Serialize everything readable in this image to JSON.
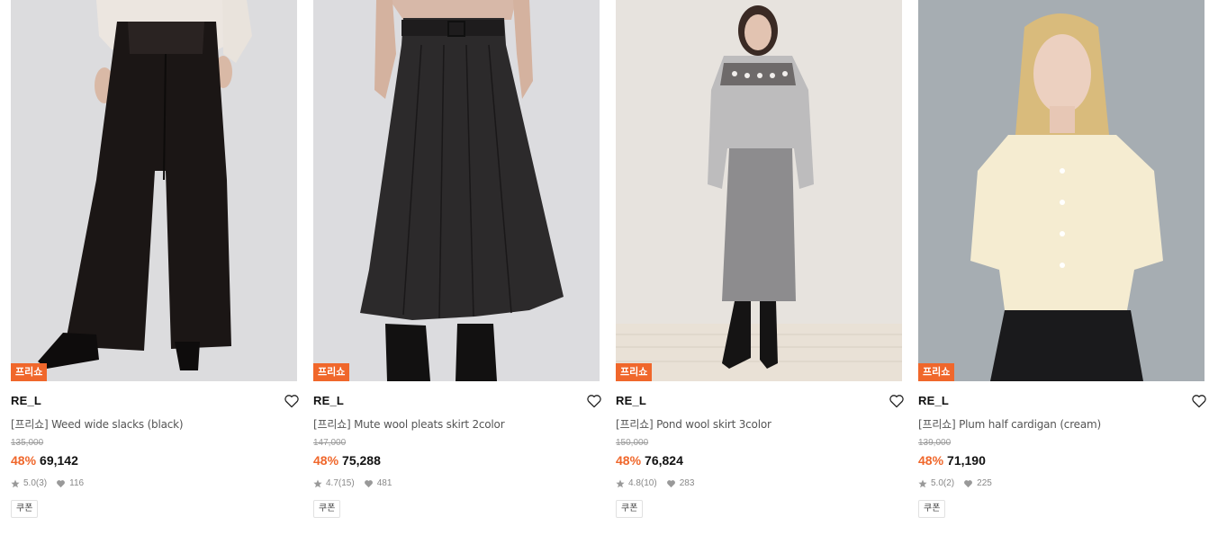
{
  "products": [
    {
      "badge": "프리쇼",
      "brand": "RE_L",
      "name": "[프리쇼] Weed wide slacks (black)",
      "original_price": "135,000",
      "discount": "48%",
      "price": "69,142",
      "rating": "5.0",
      "review_count": "(3)",
      "likes": "116",
      "coupon": "쿠폰"
    },
    {
      "badge": "프리쇼",
      "brand": "RE_L",
      "name": "[프리쇼] Mute wool pleats skirt 2color",
      "original_price": "147,000",
      "discount": "48%",
      "price": "75,288",
      "rating": "4.7",
      "review_count": "(15)",
      "likes": "481",
      "coupon": "쿠폰"
    },
    {
      "badge": "프리쇼",
      "brand": "RE_L",
      "name": "[프리쇼] Pond wool skirt 3color",
      "original_price": "150,000",
      "discount": "48%",
      "price": "76,824",
      "rating": "4.8",
      "review_count": "(10)",
      "likes": "283",
      "coupon": "쿠폰"
    },
    {
      "badge": "프리쇼",
      "brand": "RE_L",
      "name": "[프리쇼] Plum half cardigan (cream)",
      "original_price": "139,000",
      "discount": "48%",
      "price": "71,190",
      "rating": "5.0",
      "review_count": "(2)",
      "likes": "225",
      "coupon": "쿠폰"
    }
  ],
  "colors": {
    "accent": "#f0672b",
    "text": "#111111",
    "muted": "#888888"
  },
  "icons": {
    "wishlist": "heart-outline-icon",
    "rating": "star-icon",
    "likes": "heart-filled-icon"
  }
}
